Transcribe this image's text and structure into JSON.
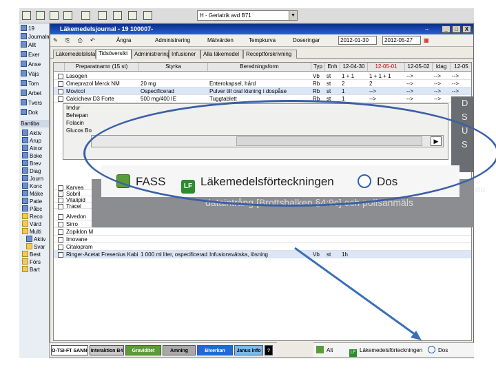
{
  "toolbar": {
    "unit_select": "H - Geriatrik avd B71"
  },
  "left_panel": {
    "top_items": [
      "19",
      "Journalm",
      "Allt",
      "Exer",
      "Anse",
      "Väjs",
      "Tom",
      "Arbet",
      "Tvers",
      "Dok"
    ],
    "section_label": "Bantiba",
    "tree_items": [
      "Aktiv",
      "Arup",
      "Ainor",
      "Boke",
      "Brev",
      "Diag",
      "Journ",
      "Konc",
      "Mäke",
      "Patie",
      "Påbc",
      "Reco",
      "Värd",
      "Multi",
      "Aktiv",
      "Svar",
      "Best",
      "Förs",
      "Bart"
    ]
  },
  "window": {
    "title": "Läkemedelsjournal - 19 100007-",
    "minimize": "_",
    "maximize": "□",
    "close": "X",
    "nav_arrow": "→"
  },
  "menu": {
    "items": [
      "Ångra",
      "Administrering",
      "Mätvärden",
      "Tempkurva",
      "Doseringar"
    ],
    "date_from": "2012-01-30",
    "date_to": "2012-05-27"
  },
  "tabs": [
    "Läkemedelslista",
    "Tidsöversikt",
    "Administrering",
    "Infusioner",
    "Alla läkemedel",
    "Receptförskrivning"
  ],
  "grid": {
    "headers": [
      "Preparatnamn (15 st)",
      "Styrka",
      "Beredningsform",
      "Typ",
      "Enh",
      "12-04-30",
      "12-05-01",
      "12-05-02",
      "Idag",
      "12-05"
    ],
    "rows": [
      {
        "name": "Lasogen",
        "strength": "",
        "form": "",
        "typ": "Vb",
        "enh": "st",
        "d1": "1 + 1",
        "d2": "1 + 1 + 1",
        "d3": "-->",
        "d4": "-->",
        "d5": "-->"
      },
      {
        "name": "Omeprazol Merck NM",
        "strength": "20 mg",
        "form": "Enterokapsel, hård",
        "typ": "Rb",
        "enh": "st",
        "d1": "2",
        "d2": "2",
        "d3": "-->",
        "d4": "-->",
        "d5": "-->"
      },
      {
        "name": "Movicol",
        "strength": "Ospecificerad",
        "form": "Pulver till oral lösning i dospåse",
        "typ": "Rb",
        "enh": "st",
        "d1": "1",
        "d2": "-->",
        "d3": "-->",
        "d4": "-->",
        "d5": "-->"
      },
      {
        "name": "Calcichew D3 Forte",
        "strength": "500 mg/400 IE",
        "form": "Tuggtablett",
        "typ": "Rb",
        "enh": "st",
        "d1": "1",
        "d2": "-->",
        "d3": "-->",
        "d4": "-->",
        "d5": "-->"
      }
    ],
    "popup_side": [
      "Imdur",
      "Behepan",
      "Folacin",
      "Glucos Bo",
      "Alvedon"
    ],
    "lower_rows": [
      {
        "name": "Alvedon",
        "strength": "",
        "form": "",
        "typ": "",
        "enh": "",
        "d1": "",
        "d2": "",
        "d3": "",
        "d4": "",
        "d5": ""
      },
      {
        "name": "Sirro",
        "strength": "",
        "form": "",
        "typ": "",
        "enh": "",
        "d1": "",
        "d2": "",
        "d3": "",
        "d4": "",
        "d5": ""
      },
      {
        "name": "Zopiklon M",
        "strength": "",
        "form": "",
        "typ": "",
        "enh": "",
        "d1": "",
        "d2": "",
        "d3": "",
        "d4": "",
        "d5": ""
      },
      {
        "name": "Imovane",
        "strength": "",
        "form": "",
        "typ": "",
        "enh": "",
        "d1": "",
        "d2": "",
        "d3": "",
        "d4": "",
        "d5": ""
      },
      {
        "name": "Citalopram",
        "strength": "",
        "form": "",
        "typ": "",
        "enh": "",
        "d1": "",
        "d2": "",
        "d3": "",
        "d4": "",
        "d5": ""
      },
      {
        "name": "Ringer-Acetat Fresenius Kabi",
        "strength": "1 000 ml liter, ospecificerad",
        "form": "Infusionsvätska, lösning",
        "typ": "Vb",
        "enh": "st",
        "d1": "1h",
        "d2": "",
        "d3": "",
        "d4": "",
        "d5": ""
      }
    ],
    "mid_side": [
      "Karvea",
      "Sobril",
      "Vitalipid",
      "Tracel"
    ]
  },
  "overlay": {
    "dark_panel_lines": [
      "D",
      "S",
      "U",
      "S"
    ],
    "info_line1": "jou",
    "info_line2": "dataintrång [Brottsbalken §4:9c] och polisanmäls",
    "links": [
      "FASS",
      "Läkemedelsförteckningen",
      "Dos"
    ],
    "lf_badge": "LF"
  },
  "bottom_tabs": [
    {
      "label": "O-TSI-FT SANNOS",
      "bg": "#ffffff"
    },
    {
      "label": "Interaktion B4",
      "bg": "#c8c8c8"
    },
    {
      "label": "Graviditet",
      "bg": "#5a9c3a"
    },
    {
      "label": "Amning",
      "bg": "#a8a8a8"
    },
    {
      "label": "Biverkan",
      "bg": "#1e6ad8"
    },
    {
      "label": "Janus info",
      "bg": "#7ab8e8"
    },
    {
      "label": "?",
      "bg": "#000000"
    }
  ],
  "bottom_links": [
    "Alt",
    "Läkemedelsförteckningen",
    "Dos"
  ],
  "colors": {
    "accent": "#3a5fa8",
    "titlebar": "#0b2e8a"
  }
}
